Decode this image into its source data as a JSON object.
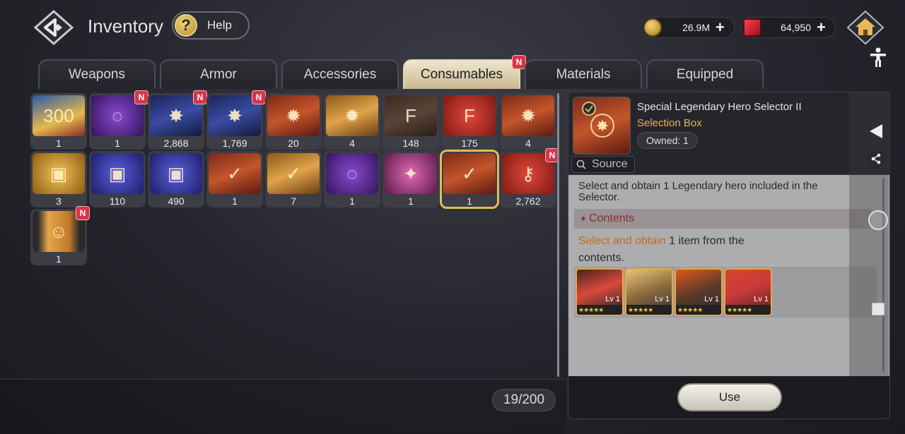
{
  "header": {
    "title": "Inventory",
    "help_label": "Help",
    "help_symbol": "?",
    "gold": "26.9M",
    "gems": "64,950"
  },
  "tabs": [
    {
      "label": "Weapons",
      "active": false,
      "new": false
    },
    {
      "label": "Armor",
      "active": false,
      "new": false
    },
    {
      "label": "Accessories",
      "active": false,
      "new": false
    },
    {
      "label": "Consumables",
      "active": true,
      "new": true
    },
    {
      "label": "Materials",
      "active": false,
      "new": false
    },
    {
      "label": "Equipped",
      "active": false,
      "new": false
    }
  ],
  "badge_label": "N",
  "items": [
    {
      "qty": "1",
      "art": "box-mixed",
      "new": false,
      "symbol": "300"
    },
    {
      "qty": "1",
      "art": "box-purple",
      "new": true,
      "symbol": "◌"
    },
    {
      "qty": "2,868",
      "art": "card-blue",
      "new": true,
      "symbol": "✸"
    },
    {
      "qty": "1,769",
      "art": "card-blue",
      "new": true,
      "symbol": "✸"
    },
    {
      "qty": "20",
      "art": "card-red",
      "new": false,
      "symbol": "✹"
    },
    {
      "qty": "4",
      "art": "card-gold",
      "new": false,
      "symbol": "✹"
    },
    {
      "qty": "148",
      "art": "card-brown",
      "new": false,
      "symbol": "F"
    },
    {
      "qty": "175",
      "art": "chest-red",
      "new": false,
      "symbol": "F"
    },
    {
      "qty": "4",
      "art": "card-red",
      "new": false,
      "symbol": "✹"
    },
    {
      "qty": "3",
      "art": "chest-gold",
      "new": false,
      "symbol": "▣"
    },
    {
      "qty": "110",
      "art": "chest-blue",
      "new": false,
      "symbol": "▣"
    },
    {
      "qty": "490",
      "art": "chest-blue",
      "new": false,
      "symbol": "▣"
    },
    {
      "qty": "1",
      "art": "card-red",
      "new": false,
      "symbol": "✓"
    },
    {
      "qty": "7",
      "art": "card-gold",
      "new": false,
      "symbol": "✓"
    },
    {
      "qty": "1",
      "art": "box-purple",
      "new": false,
      "symbol": "◌"
    },
    {
      "qty": "1",
      "art": "box-pink",
      "new": false,
      "symbol": "✦"
    },
    {
      "qty": "1",
      "art": "card-red",
      "new": false,
      "symbol": "✓",
      "selected": true
    },
    {
      "qty": "2,762",
      "art": "chest-red",
      "new": true,
      "symbol": "⚷"
    },
    {
      "qty": "1",
      "art": "ticket",
      "new": true,
      "symbol": "☺"
    }
  ],
  "slot_count": "19/200",
  "detail": {
    "name": "Special Legendary Hero Selector II",
    "type": "Selection Box",
    "owned": "Owned: 1",
    "source_label": "Source",
    "description": "Select and obtain 1 Legendary hero included in the Selector.",
    "contents_label": "Contents",
    "contents_marker": "✦",
    "select_highlight": "Select and obtain",
    "select_rest": " 1 item from the contents.",
    "heroes": [
      {
        "level": "Lv 1",
        "stars": "★★★★★"
      },
      {
        "level": "Lv 1",
        "stars": "★★★★★"
      },
      {
        "level": "Lv 1",
        "stars": "★★★★★"
      },
      {
        "level": "Lv 1",
        "stars": "★★★★★"
      }
    ],
    "use_label": "Use"
  },
  "colors": {
    "accent_gold": "#e2bd58",
    "badge_red": "#d8354a",
    "item_type": "#e6b15a"
  }
}
